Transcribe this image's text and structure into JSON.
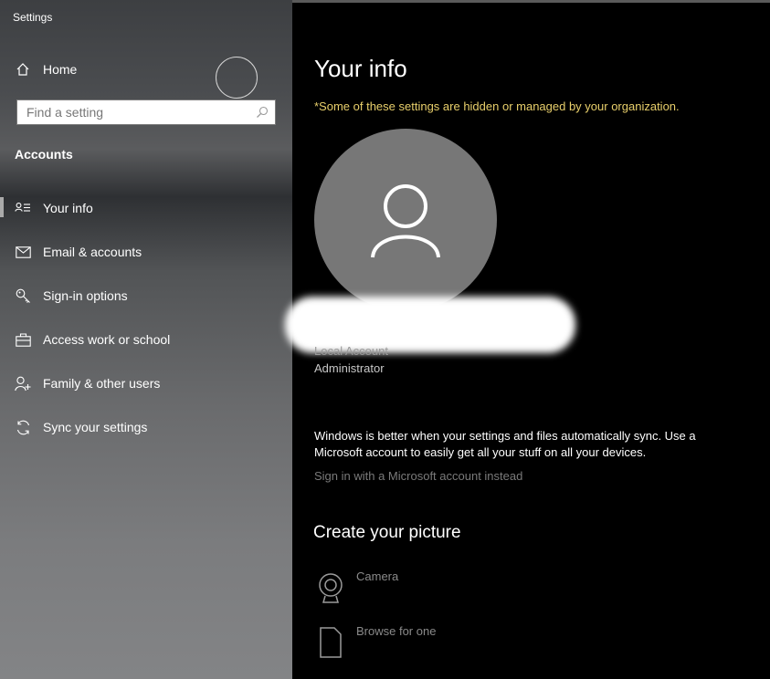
{
  "app": {
    "title": "Settings"
  },
  "sidebar": {
    "home_label": "Home",
    "search_placeholder": "Find a setting",
    "section_heading": "Accounts",
    "items": [
      {
        "label": "Your info",
        "icon": "person-card-icon",
        "active": true
      },
      {
        "label": "Email & accounts",
        "icon": "mail-icon"
      },
      {
        "label": "Sign-in options",
        "icon": "key-icon"
      },
      {
        "label": "Access work or school",
        "icon": "briefcase-icon"
      },
      {
        "label": "Family & other users",
        "icon": "person-add-icon"
      },
      {
        "label": "Sync your settings",
        "icon": "sync-icon"
      }
    ]
  },
  "main": {
    "title": "Your info",
    "notice": "*Some of these settings are hidden or managed by your organization.",
    "account_type": "Local Account",
    "account_role": "Administrator",
    "sync_message": "Windows is better when your settings and files automatically sync. Use a Microsoft account to easily get all your stuff on all your devices.",
    "signin_link": "Sign in with a Microsoft account instead",
    "create_picture": {
      "title": "Create your picture",
      "options": [
        {
          "label": "Camera",
          "icon": "camera-icon"
        },
        {
          "label": "Browse for one",
          "icon": "browse-file-icon"
        }
      ]
    }
  },
  "colors": {
    "notice": "#e8cf6b",
    "avatar": "#777777",
    "link_disabled": "#7a7a7a"
  }
}
